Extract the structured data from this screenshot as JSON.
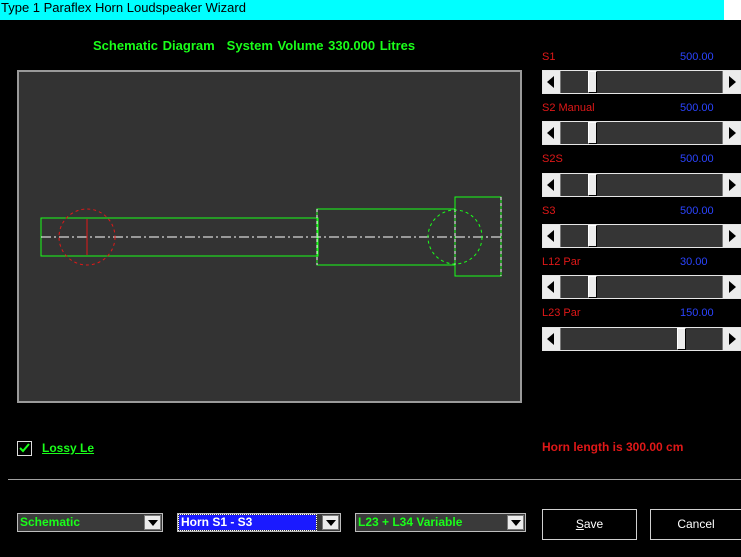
{
  "window": {
    "title": "Type 1 Paraflex Horn Loudspeaker Wizard"
  },
  "heading": {
    "diagram": "Schematic Diagram",
    "system_volume": "System Volume 330.000 Litres"
  },
  "sliders": [
    {
      "label": "S1",
      "value": "500.00",
      "position": 0.19
    },
    {
      "label": "S2  Manual",
      "value": "500.00",
      "position": 0.19
    },
    {
      "label": "S2S",
      "value": "500.00",
      "position": 0.19
    },
    {
      "label": "S3",
      "value": "500.00",
      "position": 0.19
    },
    {
      "label": "L12  Par",
      "value": "30.00",
      "position": 0.19
    },
    {
      "label": "L23  Par",
      "value": "150.00",
      "position": 0.74
    }
  ],
  "lossy": {
    "label": "Lossy Le",
    "checked": true
  },
  "horn_length": "Horn length is 300.00 cm",
  "dropdowns": {
    "view": "Schematic",
    "horn": "Horn S1 - S3",
    "mode": "L23 + L34 Variable"
  },
  "buttons": {
    "save": {
      "hotkey": "S",
      "rest": "ave"
    },
    "cancel": "Cancel"
  },
  "colors": {
    "title_bar": "#00ffff",
    "accent_green": "#1aff1a",
    "label_red": "#e01818",
    "value_blue": "#2b44ff",
    "selection_blue": "#1a1aff",
    "canvas": "#333333"
  }
}
